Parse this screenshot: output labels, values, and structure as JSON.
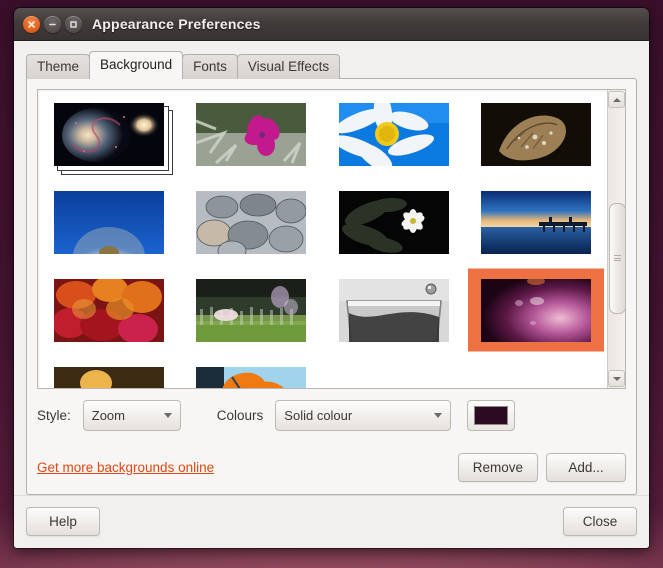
{
  "window": {
    "title": "Appearance Preferences",
    "controls": [
      {
        "name": "close-button",
        "icon": "close-icon"
      },
      {
        "name": "minimize-button",
        "icon": "minimize-icon"
      },
      {
        "name": "maximize-button",
        "icon": "maximize-icon"
      }
    ]
  },
  "tabs": [
    {
      "label": "Theme",
      "active": false
    },
    {
      "label": "Background",
      "active": true
    },
    {
      "label": "Fonts",
      "active": false
    },
    {
      "label": "Visual Effects",
      "active": false
    }
  ],
  "wallpapers": [
    {
      "name": "all-wallpapers-stack",
      "selected": false,
      "stacked": true,
      "desc": "spiral galaxy photo stack"
    },
    {
      "name": "pink-flower",
      "selected": false,
      "stacked": false,
      "desc": "magenta flower on silver foliage"
    },
    {
      "name": "daisy-blue-sky",
      "selected": false,
      "stacked": false,
      "desc": "white daisy with yellow centre on blue"
    },
    {
      "name": "dewy-leaf",
      "selected": false,
      "stacked": false,
      "desc": "sepia maple leaf with water drops"
    },
    {
      "name": "dandelion",
      "selected": false,
      "stacked": false,
      "desc": "dandelion seed head on deep blue"
    },
    {
      "name": "pebbles",
      "selected": false,
      "stacked": false,
      "desc": "grey river pebbles"
    },
    {
      "name": "white-flower-dark",
      "selected": false,
      "stacked": false,
      "desc": "white flower on black foliage"
    },
    {
      "name": "pier-sunset",
      "selected": false,
      "stacked": false,
      "desc": "pier at blue-hour over calm water"
    },
    {
      "name": "red-bokeh",
      "selected": false,
      "stacked": false,
      "desc": "red and orange bokeh blur"
    },
    {
      "name": "green-grass-bokeh",
      "selected": false,
      "stacked": false,
      "desc": "green grass with soft white bokeh"
    },
    {
      "name": "glass-monochrome",
      "selected": false,
      "stacked": false,
      "desc": "black and white glass of water"
    },
    {
      "name": "ubuntu-warty-final",
      "selected": true,
      "stacked": false,
      "desc": "purple Ubuntu default wallpaper"
    },
    {
      "name": "dark-sunrise",
      "selected": false,
      "stacked": false,
      "desc": "dark horizon with warm sun"
    },
    {
      "name": "orange-poppy",
      "selected": false,
      "stacked": false,
      "desc": "orange poppy against blue sky"
    }
  ],
  "style_row": {
    "style_label": "Style:",
    "style_value": "Zoom",
    "colours_label": "Colours",
    "colours_value": "Solid colour",
    "colour_swatch_hex": "#2c0a22"
  },
  "links": {
    "more_backgrounds": "Get more backgrounds online"
  },
  "buttons": {
    "remove": "Remove",
    "add": "Add...",
    "help": "Help",
    "close": "Close"
  },
  "theme": {
    "accent_hex": "#dd4814",
    "selection_hex": "#ed7142",
    "titlebar_hex": "#413c3a",
    "window_bg_hex": "#f2f0ee",
    "desktop_hex": "#3a0f2b"
  },
  "scrollbar": {
    "up_icon": "chevron-up-icon",
    "down_icon": "chevron-down-icon",
    "position_percent": 36
  }
}
